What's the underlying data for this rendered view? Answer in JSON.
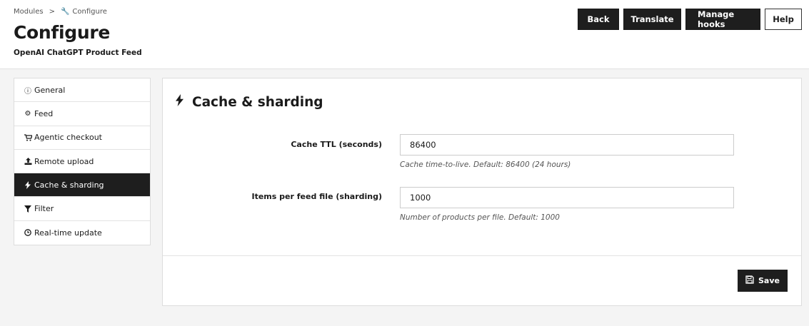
{
  "breadcrumb": {
    "parent": "Modules",
    "separator": ">",
    "current_icon": "wrench-icon",
    "current": "Configure"
  },
  "header": {
    "title": "Configure",
    "subtitle": "OpenAI ChatGPT Product Feed"
  },
  "toolbar": {
    "back_label": "Back",
    "translate_label": "Translate",
    "manage_hooks_label": "Manage hooks",
    "help_label": "Help"
  },
  "sidebar": {
    "items": [
      {
        "label": "General",
        "icon": "info-circle-icon",
        "active": false
      },
      {
        "label": "Feed",
        "icon": "cogs-icon",
        "active": false
      },
      {
        "label": "Agentic checkout",
        "icon": "shopping-cart-icon",
        "active": false
      },
      {
        "label": "Remote upload",
        "icon": "upload-icon",
        "active": false
      },
      {
        "label": "Cache & sharding",
        "icon": "bolt-icon",
        "active": true
      },
      {
        "label": "Filter",
        "icon": "filter-icon",
        "active": false
      },
      {
        "label": "Real-time update",
        "icon": "clock-icon",
        "active": false
      }
    ]
  },
  "panel": {
    "heading": "Cache & sharding",
    "heading_icon": "bolt-icon",
    "fields": {
      "cache_ttl": {
        "label": "Cache TTL (seconds)",
        "value": "86400",
        "help": "Cache time-to-live. Default: 86400 (24 hours)"
      },
      "items_per_file": {
        "label": "Items per feed file (sharding)",
        "value": "1000",
        "help": "Number of products per file. Default: 1000"
      }
    },
    "save_label": "Save"
  },
  "colors": {
    "dark": "#1e1e1e",
    "background": "#f4f4f4",
    "panel": "#ffffff",
    "border": "#dddddd"
  }
}
